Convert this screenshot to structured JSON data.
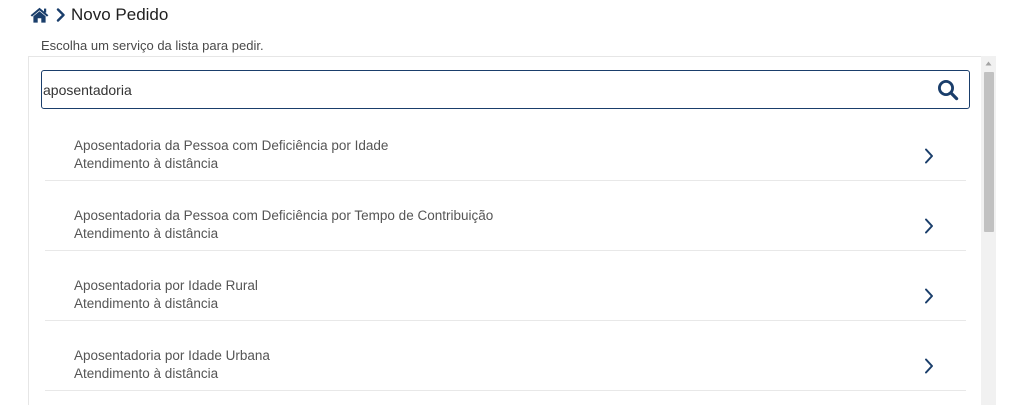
{
  "breadcrumb": {
    "home_icon": "home-icon",
    "separator_icon": "chevron-right-icon",
    "title": "Novo Pedido"
  },
  "instruction": "Escolha um serviço da lista para pedir.",
  "search": {
    "value": "aposentadoria",
    "icon": "search-icon"
  },
  "services": [
    {
      "name": "Aposentadoria da Pessoa com Deficiência por Idade",
      "mode": "Atendimento à distância"
    },
    {
      "name": "Aposentadoria da Pessoa com Deficiência por Tempo de Contribuição",
      "mode": "Atendimento à distância"
    },
    {
      "name": "Aposentadoria por Idade Rural",
      "mode": "Atendimento à distância"
    },
    {
      "name": "Aposentadoria por Idade Urbana",
      "mode": "Atendimento à distância"
    }
  ],
  "colors": {
    "primary": "#1a3e6b",
    "text": "#555555",
    "divider": "#e8e8e8"
  }
}
